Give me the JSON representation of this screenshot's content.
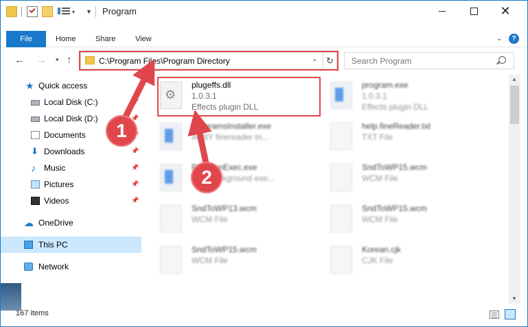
{
  "window": {
    "title": "Program"
  },
  "ribbon": {
    "tabs": [
      "File",
      "Home",
      "Share",
      "View"
    ]
  },
  "address_bar": {
    "path": "C:\\Program Files\\Program Directory"
  },
  "search": {
    "placeholder": "Search Program"
  },
  "sidebar": {
    "items": [
      {
        "label": "Quick access",
        "icon": "star-icon"
      },
      {
        "label": "Local Disk (C:)",
        "icon": "drive-icon"
      },
      {
        "label": "Local Disk (D:)",
        "icon": "drive-icon"
      },
      {
        "label": "Documents",
        "icon": "documents-icon"
      },
      {
        "label": "Downloads",
        "icon": "downloads-icon"
      },
      {
        "label": "Music",
        "icon": "music-icon"
      },
      {
        "label": "Pictures",
        "icon": "pictures-icon"
      },
      {
        "label": "Videos",
        "icon": "videos-icon"
      },
      {
        "label": "OneDrive",
        "icon": "cloud-icon"
      },
      {
        "label": "This PC",
        "icon": "computer-icon"
      },
      {
        "label": "Network",
        "icon": "network-icon"
      }
    ]
  },
  "files": [
    {
      "name": "plugeffs.dll",
      "line2": "1.0.3.1",
      "line3": "Effects plugin DLL"
    },
    {
      "name": "program.exe",
      "line2": "1.0.3.1",
      "line3": "Effects plugin DLL"
    },
    {
      "name": "ProgramsInstaller.exe",
      "line2": "ABBY finereader tri..."
    },
    {
      "name": "help.fineReader.txt",
      "line2": "TXT File"
    },
    {
      "name": "ProgramExec.exe",
      "line2": "Run background exe..."
    },
    {
      "name": "SndToWP15.wcm",
      "line2": "WCM File"
    },
    {
      "name": "SndToWP13.wcm",
      "line2": "WCM File"
    },
    {
      "name": "SndToWP15.wcm",
      "line2": "WCM File"
    },
    {
      "name": "SndToWP15.wcm",
      "line2": "WCM File"
    },
    {
      "name": "Korean.cjk",
      "line2": "CJK File"
    }
  ],
  "status": {
    "item_count": "167 items"
  },
  "annotations": {
    "step1": "1",
    "step2": "2"
  },
  "colors": {
    "accent": "#1979ca",
    "highlight": "#e0474c",
    "selection": "#cce8ff"
  }
}
